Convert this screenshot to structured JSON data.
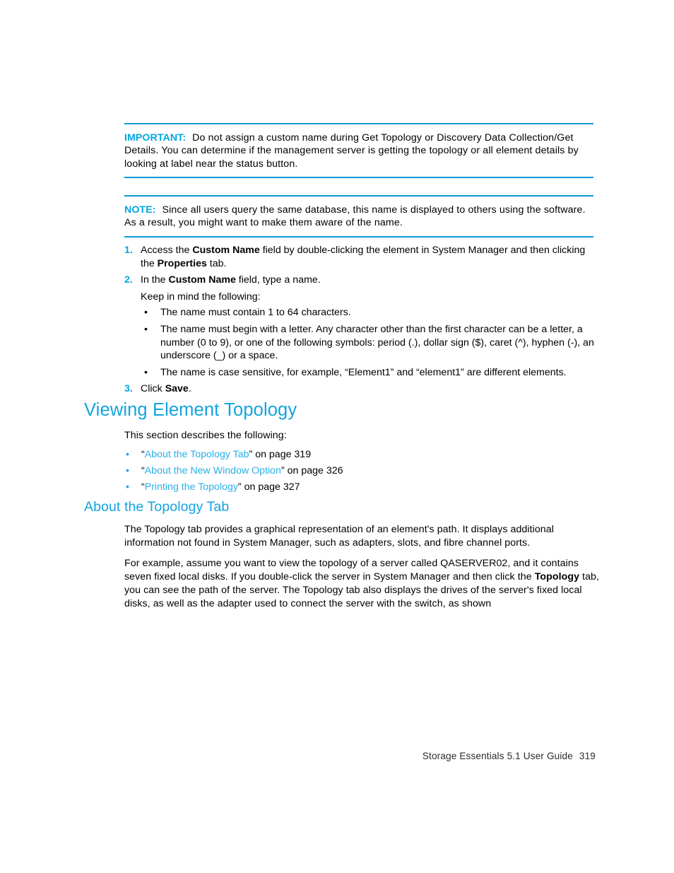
{
  "document": {
    "footer_text": "Storage Essentials 5.1 User Guide",
    "page_number": "319"
  },
  "colors": {
    "accent": "#00a6e2",
    "heading": "#12a4e0",
    "rule": "#0b9bd4",
    "link": "#2ab0e8",
    "body_text": "#000000"
  },
  "important": {
    "label": "IMPORTANT:",
    "text": "Do not assign a custom name during Get Topology or Discovery Data Collection/Get Details. You can determine if the management server is getting the topology or all element details by looking at label near the status button."
  },
  "note": {
    "label": "NOTE:",
    "text": "Since all users query the same database, this name is displayed to others using the software. As a result, you might want to make them aware of the name."
  },
  "steps": [
    {
      "number": "1.",
      "parts": [
        {
          "t": "Access the ",
          "b": false
        },
        {
          "t": "Custom Name",
          "b": true
        },
        {
          "t": " field by double-clicking the element in System Manager and then clicking the ",
          "b": false
        },
        {
          "t": "Properties",
          "b": true
        },
        {
          "t": " tab.",
          "b": false
        }
      ]
    },
    {
      "number": "2.",
      "parts": [
        {
          "t": "In the ",
          "b": false
        },
        {
          "t": "Custom Name",
          "b": true
        },
        {
          "t": " field, type a name.",
          "b": false
        }
      ]
    },
    {
      "number": "3.",
      "parts": [
        {
          "t": "Click ",
          "b": false
        },
        {
          "t": "Save",
          "b": true
        },
        {
          "t": ".",
          "b": false
        }
      ]
    }
  ],
  "step2_intro": "Keep in mind the following:",
  "step2_bullets": [
    {
      "marker": "•",
      "text": "The name must contain 1 to 64 characters."
    },
    {
      "marker": "•",
      "text": "The name must begin with a letter. Any character other than the first character can be a letter, a number (0 to 9), or one of the following symbols: period (.), dollar sign ($), caret (^), hyphen (-), an underscore (_) or a space."
    },
    {
      "marker": "•",
      "text": "The name is case sensitive, for example, “Element1” and “element1” are different elements."
    }
  ],
  "section": {
    "heading": "Viewing Element Topology",
    "intro": "This section describes the following:",
    "xrefs": [
      {
        "marker": "•",
        "open_quote": "“",
        "link": "About the Topology Tab",
        "close_quote": "”",
        "suffix": " on page 319"
      },
      {
        "marker": "•",
        "open_quote": "“",
        "link": "About the New Window Option",
        "close_quote": "”",
        "suffix": " on page 326"
      },
      {
        "marker": "•",
        "open_quote": "“",
        "link": "Printing the Topology",
        "close_quote": "”",
        "suffix": " on page 327"
      }
    ]
  },
  "subsection": {
    "heading": "About the Topology Tab",
    "paragraph1": "The Topology tab provides a graphical representation of an element's path. It displays additional information not found in System Manager, such as adapters, slots, and fibre channel ports.",
    "paragraph2_parts": [
      {
        "t": "For example, assume you want to view the topology of a server called QASERVER02, and it contains seven fixed local disks. If you double-click the server in System Manager and then click the ",
        "b": false
      },
      {
        "t": "Topology",
        "b": true
      },
      {
        "t": " tab, you can see the path of the server. The Topology tab also displays the drives of the server's fixed local disks, as well as the adapter used to connect the server with the switch, as shown",
        "b": false
      }
    ]
  }
}
